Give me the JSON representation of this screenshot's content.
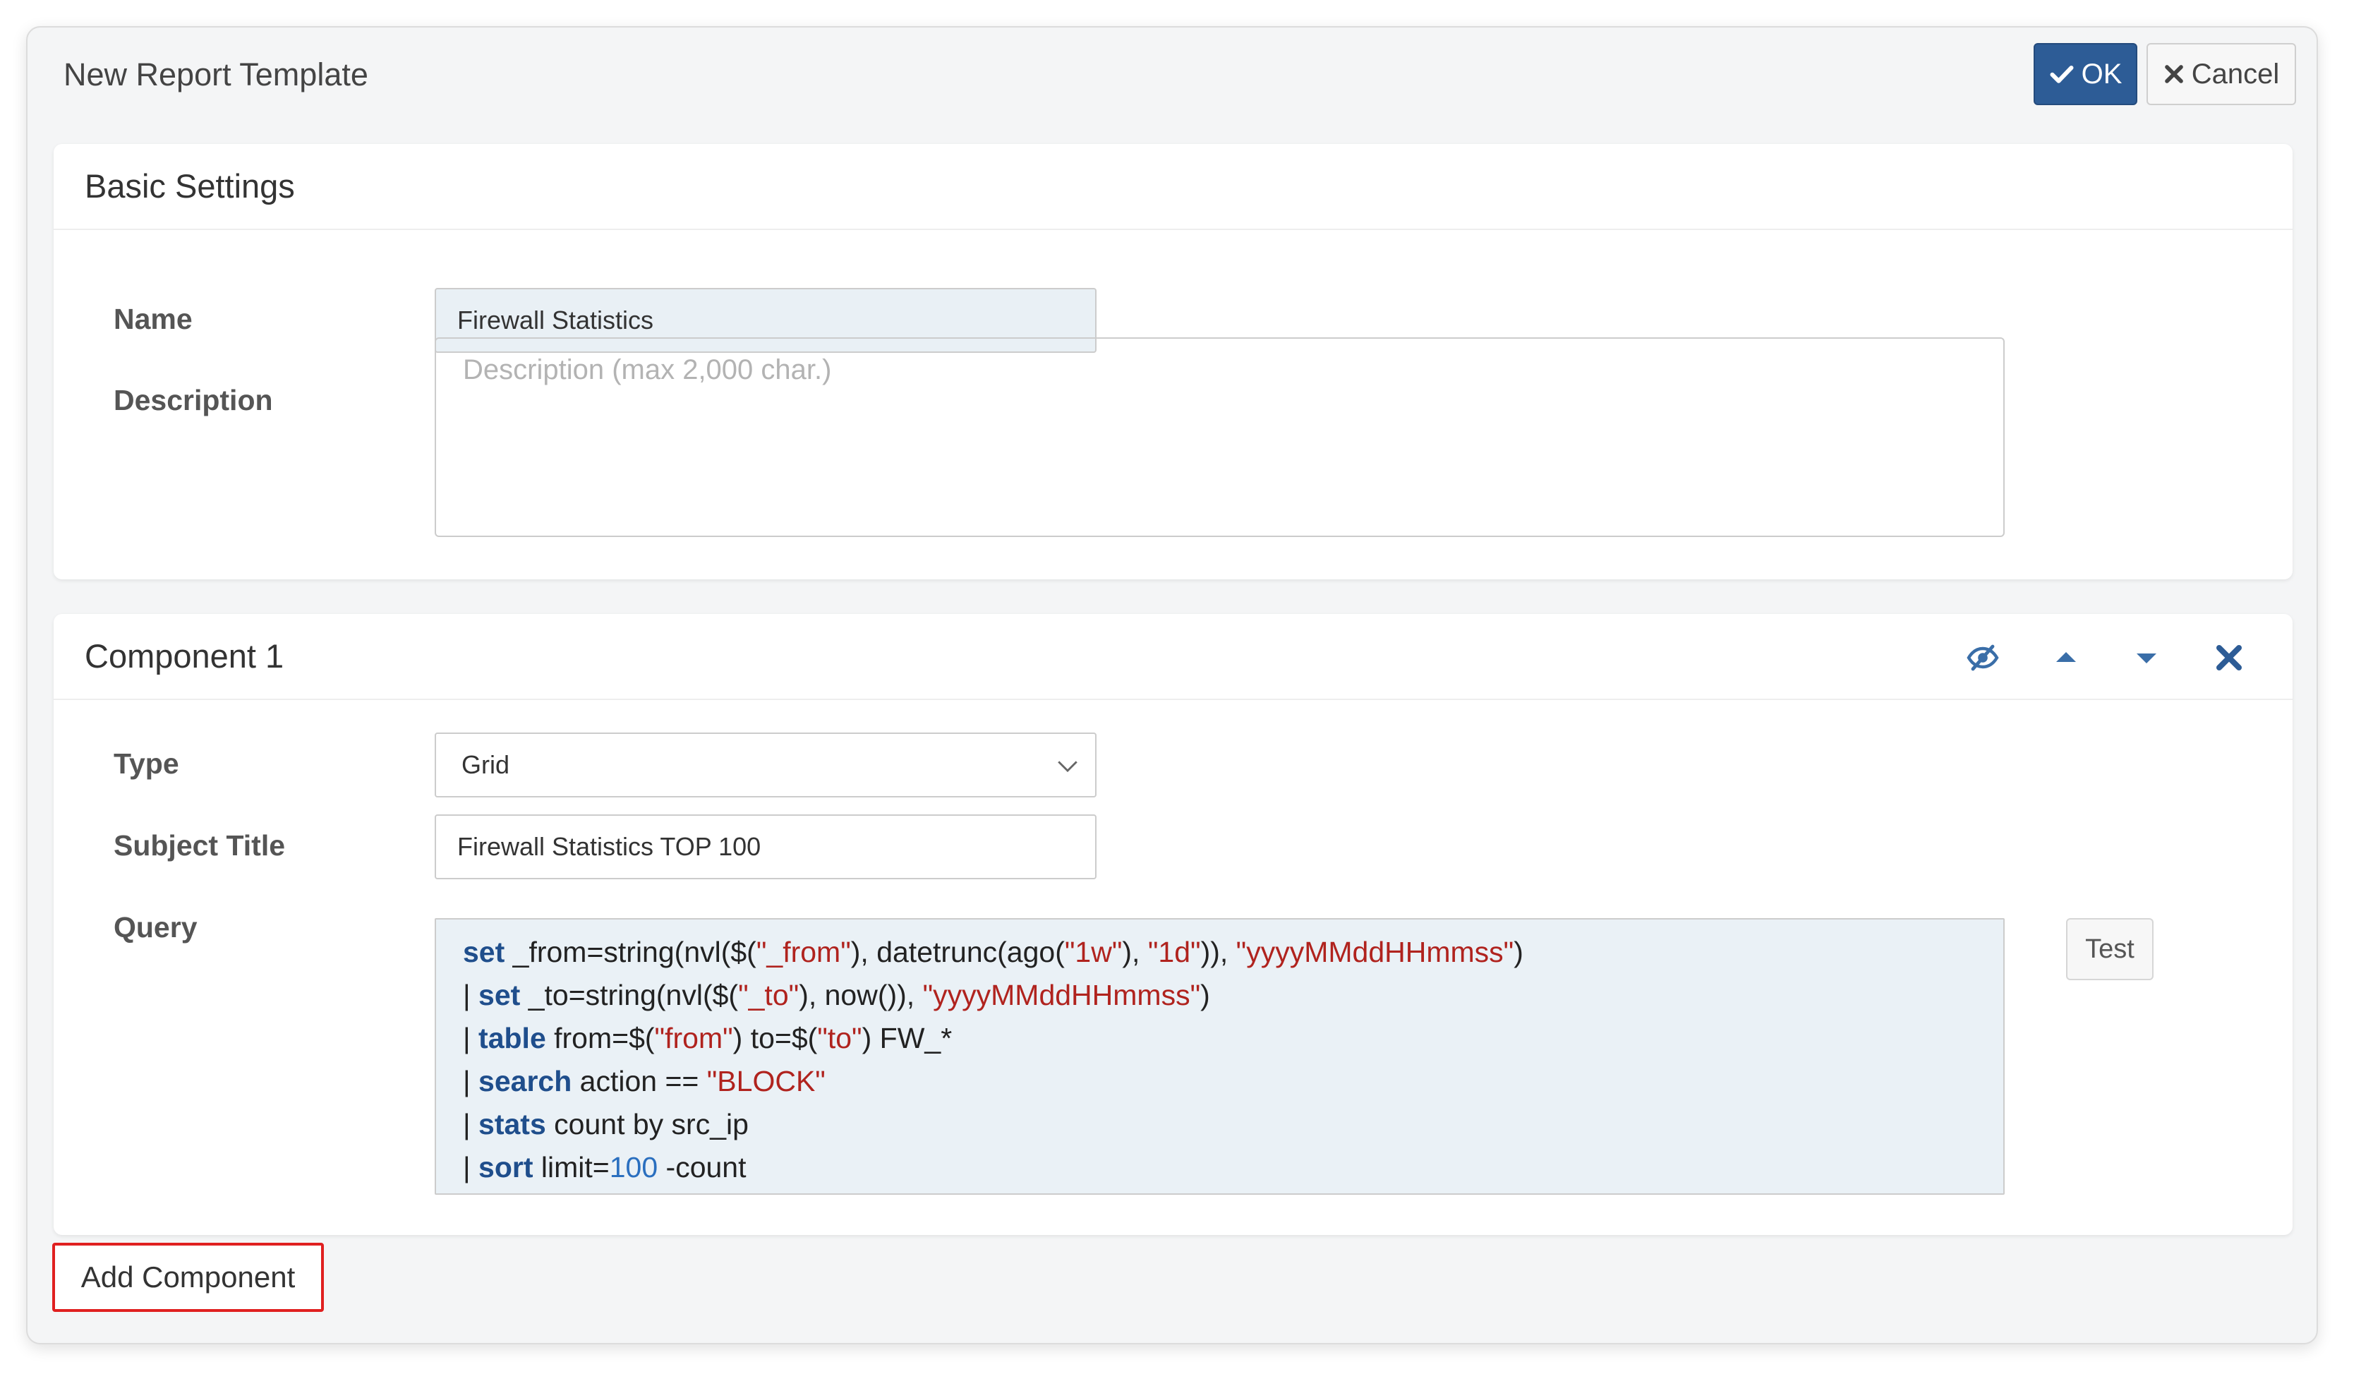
{
  "dialog": {
    "title": "New Report Template",
    "ok_label": "OK",
    "cancel_label": "Cancel"
  },
  "basic_settings": {
    "title": "Basic Settings",
    "name_label": "Name",
    "name_value": "Firewall Statistics",
    "description_label": "Description",
    "description_placeholder": "Description (max 2,000 char.)"
  },
  "component": {
    "title": "Component 1",
    "icons": [
      "eye-slash-icon",
      "arrow-up-icon",
      "arrow-down-icon",
      "close-icon"
    ],
    "type_label": "Type",
    "type_value": "Grid",
    "subject_label": "Subject Title",
    "subject_value": "Firewall Statistics TOP 100",
    "query_label": "Query",
    "query_lines": [
      "set _from=string(nvl($(\"_from\"), datetrunc(ago(\"1w\"), \"1d\")), \"yyyyMMddHHmmss\")",
      "| set _to=string(nvl($(\"_to\"), now()), \"yyyyMMddHHmmss\")",
      "| table from=$(\"from\") to=$(\"to\") FW_*",
      "| search action == \"BLOCK\"",
      "| stats count by src_ip",
      "| sort limit=100 -count"
    ],
    "test_label": "Test"
  },
  "add_component_label": "Add Component",
  "colors": {
    "primary": "#2d5c96",
    "keyword": "#1f4e8c",
    "string": "#b0231e",
    "number": "#2a6fbf",
    "highlight_border": "#e02020"
  }
}
